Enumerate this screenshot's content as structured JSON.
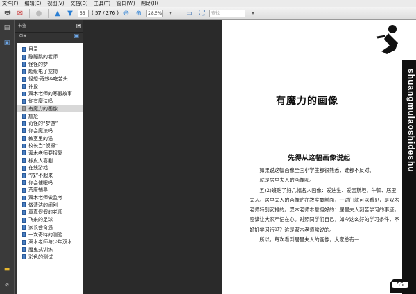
{
  "menu": [
    "文件(F)",
    "编辑(E)",
    "视图(V)",
    "文档(D)",
    "工具(T)",
    "窗口(W)",
    "帮助(H)"
  ],
  "toolbar": {
    "page_input": "55",
    "page_count": "( 57 / 276 )",
    "zoom": "28.5%",
    "search_placeholder": "查找"
  },
  "bookmarks": {
    "title": "书签",
    "items": [
      "目录",
      "蹦蹦跳的老师",
      "怪怪的梦",
      "超级电子宠物",
      "怪想·奇效&吃苦头",
      "神投",
      "双木老师的寒假故事",
      "你有魔法吗",
      "有魔力的画像",
      "尴尬",
      "奇怪的“梦游”",
      "你会魔法吗",
      "教室里的猫",
      "校长当“侦探”",
      "双木老师要报复",
      "橡皮人喜剧",
      "在线游戏",
      "“戒”不起来",
      "你会催眠吗",
      "荒唐辅导",
      "双木老师做监考",
      "做清洁的闹剧",
      "真真假假的老师",
      "飞来的足球",
      "家长会奇遇",
      "一次奇特的测验",
      "双木老师与少年双木",
      "魔鬼式训练",
      "彩色的测试"
    ],
    "selected_index": 8
  },
  "page": {
    "spine_text": "shuangmulaoshideshu",
    "chapter_title": "有魔力的画像",
    "subtitle": "先得从这幅画像说起",
    "paragraphs": [
      "如果说这幅画像全国小学生都很熟悉，谁都不反对。",
      "就是居里夫人的画像呗。",
      "五(2)班贴了好几幅名人画像：爱迪生、爱因斯坦、牛顿、居里夫人。居里夫人的画像贴在教室最前面，一进门就可以看见，是双木老师特别安排的。双木老师本意挺好的：居里夫人刻苦学习的事迹，应该让大家牢记在心。对照同学们自己，如今这么好的学习条件，不好好学习行吗？这是双木老师常说的。",
      "所以，每次看到居里夫人的画像，大家总有一"
    ],
    "page_number": "55"
  }
}
